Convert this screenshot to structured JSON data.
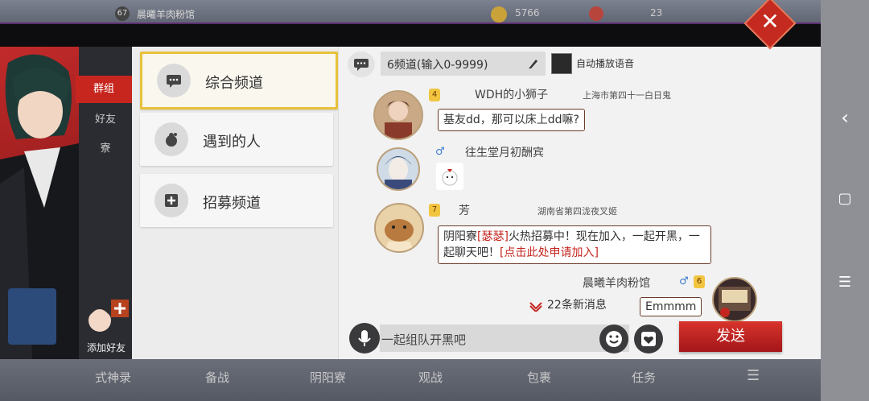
{
  "topbar": {
    "level": "67",
    "player_name": "晨曦羊肉粉馆",
    "coins": "5766",
    "jade": "23"
  },
  "tabs": [
    {
      "label": "群组"
    },
    {
      "label": "好友"
    },
    {
      "label": "寮"
    }
  ],
  "add_friend_label": "添加好友",
  "channels": [
    {
      "label": "综合频道",
      "icon": "chat-bubble-icon"
    },
    {
      "label": "遇到的人",
      "icon": "daruma-icon"
    },
    {
      "label": "招募频道",
      "icon": "recruit-plus-icon"
    }
  ],
  "chat_header": {
    "channel_input": "6频道(输入0-9999)",
    "auto_voice_label": "自动播放语音"
  },
  "messages": [
    {
      "name": "WDH的小狮子",
      "level": "4",
      "guild": "上海市第四十一白日鬼",
      "text": "基友dd，那可以床上dd嘛?"
    },
    {
      "name": "往生堂月初酬宾",
      "sticker": "sticker"
    },
    {
      "name": "芳",
      "level": "7",
      "guild": "湖南省第四泷夜叉姬",
      "text_pre": "阴阳寮",
      "text_tag": "[瑟瑟]",
      "text_mid": "火热招募中！现在加入，一起开黑，一起聊天吧！",
      "text_link": "[点击此处申请加入]"
    },
    {
      "name": "晨曦羊肉粉馆",
      "level": "6",
      "text": "Emmmm",
      "self": "true"
    }
  ],
  "new_messages": "22条新消息",
  "input": {
    "placeholder": "一起组队开黑吧"
  },
  "send_label": "发送",
  "bottom_nav": [
    {
      "label": "式神录"
    },
    {
      "label": "备战"
    },
    {
      "label": "阴阳寮"
    },
    {
      "label": "观战"
    },
    {
      "label": "包裹"
    },
    {
      "label": "任务"
    }
  ],
  "system_nav": {
    "back": "‹",
    "home": "▢",
    "menu": "☰"
  },
  "colors": {
    "accent_red": "#c7261f",
    "highlight_yellow": "#e8c13a"
  }
}
